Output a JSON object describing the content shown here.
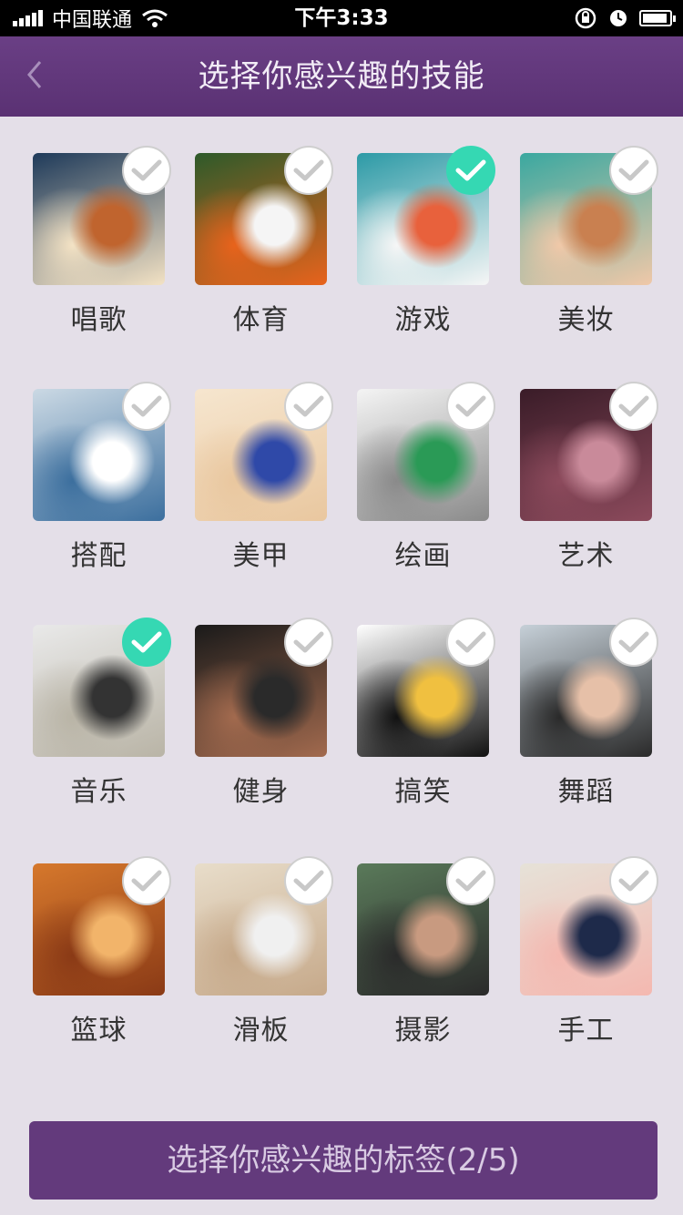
{
  "status_bar": {
    "carrier": "中国联通",
    "time": "下午3:33"
  },
  "nav": {
    "title": "选择你感兴趣的技能",
    "back_icon": "chevron-left-icon"
  },
  "skills": [
    {
      "label": "唱歌",
      "selected": false,
      "colors": [
        "#1e3a5a",
        "#f3e2c4",
        "#c0642e"
      ]
    },
    {
      "label": "体育",
      "selected": false,
      "colors": [
        "#2d5a2a",
        "#e8631c",
        "#f5f5f5"
      ]
    },
    {
      "label": "游戏",
      "selected": true,
      "colors": [
        "#2c9aa6",
        "#f6f6f6",
        "#e8613c"
      ]
    },
    {
      "label": "美妆",
      "selected": false,
      "colors": [
        "#3aa8a0",
        "#f0c8a8",
        "#c98050"
      ]
    },
    {
      "label": "搭配",
      "selected": false,
      "colors": [
        "#cbd9e4",
        "#3c6f9e",
        "#ffffff"
      ]
    },
    {
      "label": "美甲",
      "selected": false,
      "colors": [
        "#f6e6cf",
        "#e9c79f",
        "#2f49a8"
      ]
    },
    {
      "label": "绘画",
      "selected": false,
      "colors": [
        "#f4f4f4",
        "#8a8a8a",
        "#2a9a56"
      ]
    },
    {
      "label": "艺术",
      "selected": false,
      "colors": [
        "#3a1c28",
        "#8c4a5c",
        "#c98a9a"
      ]
    },
    {
      "label": "音乐",
      "selected": true,
      "colors": [
        "#e9e9e9",
        "#b9b4a6",
        "#333333"
      ]
    },
    {
      "label": "健身",
      "selected": false,
      "colors": [
        "#1a1a1a",
        "#a26a4e",
        "#2a2a2a"
      ]
    },
    {
      "label": "搞笑",
      "selected": false,
      "colors": [
        "#ffffff",
        "#111111",
        "#f0c040"
      ]
    },
    {
      "label": "舞蹈",
      "selected": false,
      "colors": [
        "#c6d0d8",
        "#2a2a2a",
        "#e6c0a8"
      ]
    },
    {
      "label": "篮球",
      "selected": false,
      "colors": [
        "#d6782c",
        "#8a3a16",
        "#f2b46a"
      ]
    },
    {
      "label": "滑板",
      "selected": false,
      "colors": [
        "#e8ddca",
        "#c6a98a",
        "#f0f0f0"
      ]
    },
    {
      "label": "摄影",
      "selected": false,
      "colors": [
        "#5a7a5a",
        "#2a2a2a",
        "#c89a80"
      ]
    },
    {
      "label": "手工",
      "selected": false,
      "colors": [
        "#e6e2d8",
        "#f4b8b0",
        "#1e2a4a"
      ]
    }
  ],
  "bottom_button": {
    "label": "选择你感兴趣的标签(2/5)"
  },
  "theme": {
    "primary": "#633a7c",
    "check_on": "#35d8b3",
    "background": "#e4dfe8"
  }
}
